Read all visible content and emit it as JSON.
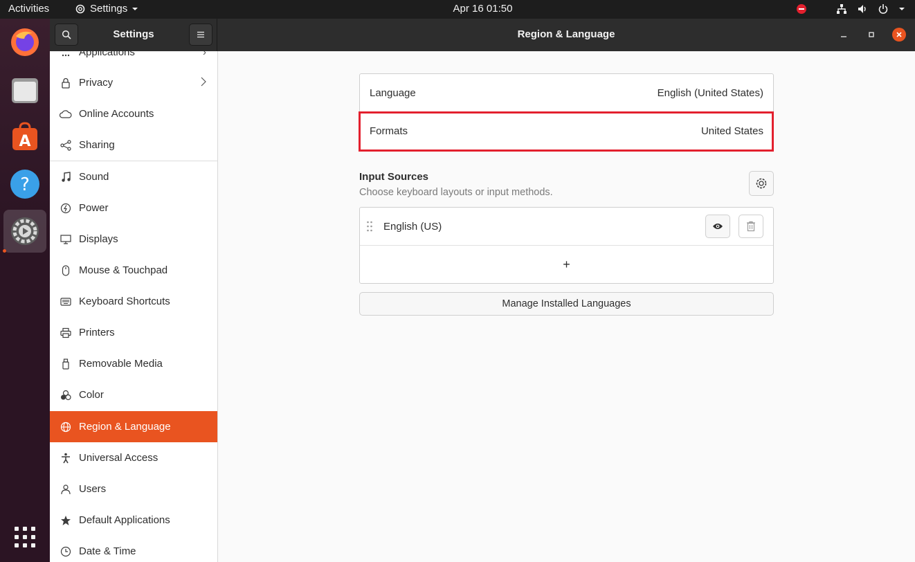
{
  "topbar": {
    "activities": "Activities",
    "app_name": "Settings",
    "clock": "Apr 16  01:50"
  },
  "dock": {
    "items": [
      "firefox-icon",
      "files-icon",
      "software-icon",
      "help-icon",
      "settings-icon",
      "show-apps-icon"
    ]
  },
  "header": {
    "sidebar_title": "Settings",
    "main_title": "Region & Language"
  },
  "sidebar": {
    "items": [
      {
        "label": "Applications",
        "icon": "applications-icon"
      },
      {
        "label": "Privacy",
        "icon": "lock-icon"
      },
      {
        "label": "Online Accounts",
        "icon": "cloud-icon"
      },
      {
        "label": "Sharing",
        "icon": "share-icon"
      },
      {
        "label": "Sound",
        "icon": "music-note-icon"
      },
      {
        "label": "Power",
        "icon": "power-icon"
      },
      {
        "label": "Displays",
        "icon": "display-icon"
      },
      {
        "label": "Mouse & Touchpad",
        "icon": "mouse-icon"
      },
      {
        "label": "Keyboard Shortcuts",
        "icon": "keyboard-icon"
      },
      {
        "label": "Printers",
        "icon": "printer-icon"
      },
      {
        "label": "Removable Media",
        "icon": "usb-icon"
      },
      {
        "label": "Color",
        "icon": "color-icon"
      },
      {
        "label": "Region & Language",
        "icon": "globe-icon"
      },
      {
        "label": "Universal Access",
        "icon": "accessibility-icon"
      },
      {
        "label": "Users",
        "icon": "users-icon"
      },
      {
        "label": "Default Applications",
        "icon": "star-icon"
      },
      {
        "label": "Date & Time",
        "icon": "clock-icon"
      }
    ],
    "selected": "Region & Language"
  },
  "main": {
    "language_label": "Language",
    "language_value": "English (United States)",
    "formats_label": "Formats",
    "formats_value": "United States",
    "input_sources_title": "Input Sources",
    "input_sources_subtitle": "Choose keyboard layouts or input methods.",
    "input_sources": [
      {
        "name": "English (US)"
      }
    ],
    "add_label": "+",
    "manage_button": "Manage Installed Languages"
  },
  "colors": {
    "accent": "#e95420",
    "highlight_box": "#e3202e",
    "topbar": "#1d1d1d",
    "headerbar": "#2d2d2d"
  }
}
